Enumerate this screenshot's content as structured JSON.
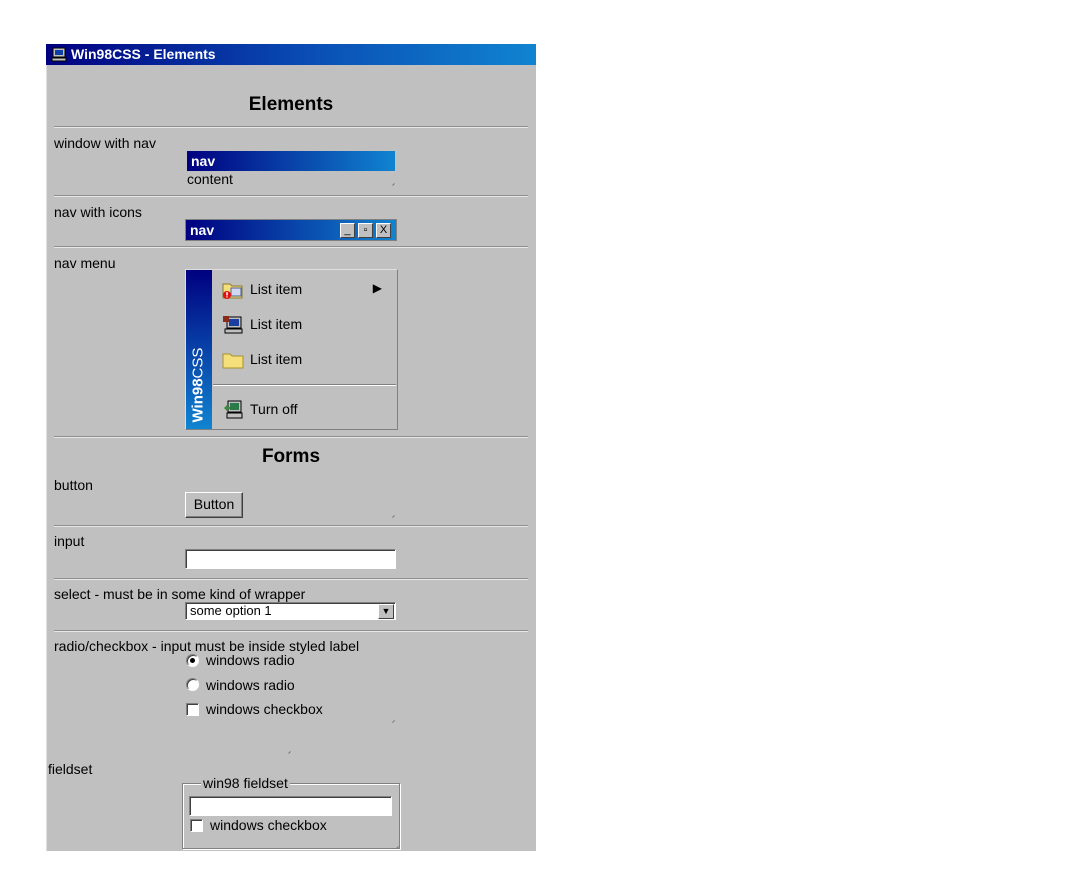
{
  "window": {
    "title": "Win98CSS - Elements"
  },
  "elements_heading": "Elements",
  "forms_heading": "Forms",
  "labels": {
    "window_with_nav": "window with nav",
    "nav_with_icons": "nav with icons",
    "nav_menu": "nav menu",
    "button": "button",
    "input": "input",
    "select": "select - must be in some kind of wrapper",
    "radio_checkbox": "radio/checkbox - input must be inside styled label",
    "fieldset": "fieldset"
  },
  "window_with_nav": {
    "nav": "nav",
    "content": "content"
  },
  "nav_with_icons": {
    "nav": "nav",
    "minimize": "_",
    "maximize": "▫",
    "close": "X"
  },
  "nav_menu": {
    "sidebar_bold": "Win98",
    "sidebar_rest": "CSS",
    "items": [
      {
        "label": "List item",
        "icon": "folder-warning-icon",
        "arrow": "▶"
      },
      {
        "label": "List item",
        "icon": "computer-icon"
      },
      {
        "label": "List item",
        "icon": "folder-icon"
      }
    ],
    "turn_off": {
      "label": "Turn off",
      "icon": "shutdown-computer-icon"
    }
  },
  "button": {
    "label": "Button"
  },
  "input": {
    "value": ""
  },
  "select": {
    "selected": "some option 1",
    "arrow": "▼"
  },
  "radio_checkbox": {
    "radio1": {
      "label": "windows radio",
      "checked": true
    },
    "radio2": {
      "label": "windows radio",
      "checked": false
    },
    "checkbox": {
      "label": "windows checkbox",
      "checked": false
    }
  },
  "fieldset": {
    "legend": "win98 fieldset",
    "input_value": "",
    "checkbox": {
      "label": "windows checkbox",
      "checked": false
    }
  },
  "colors": {
    "face": "#c0c0c0",
    "title_start": "#000080",
    "title_end": "#1084d0"
  }
}
